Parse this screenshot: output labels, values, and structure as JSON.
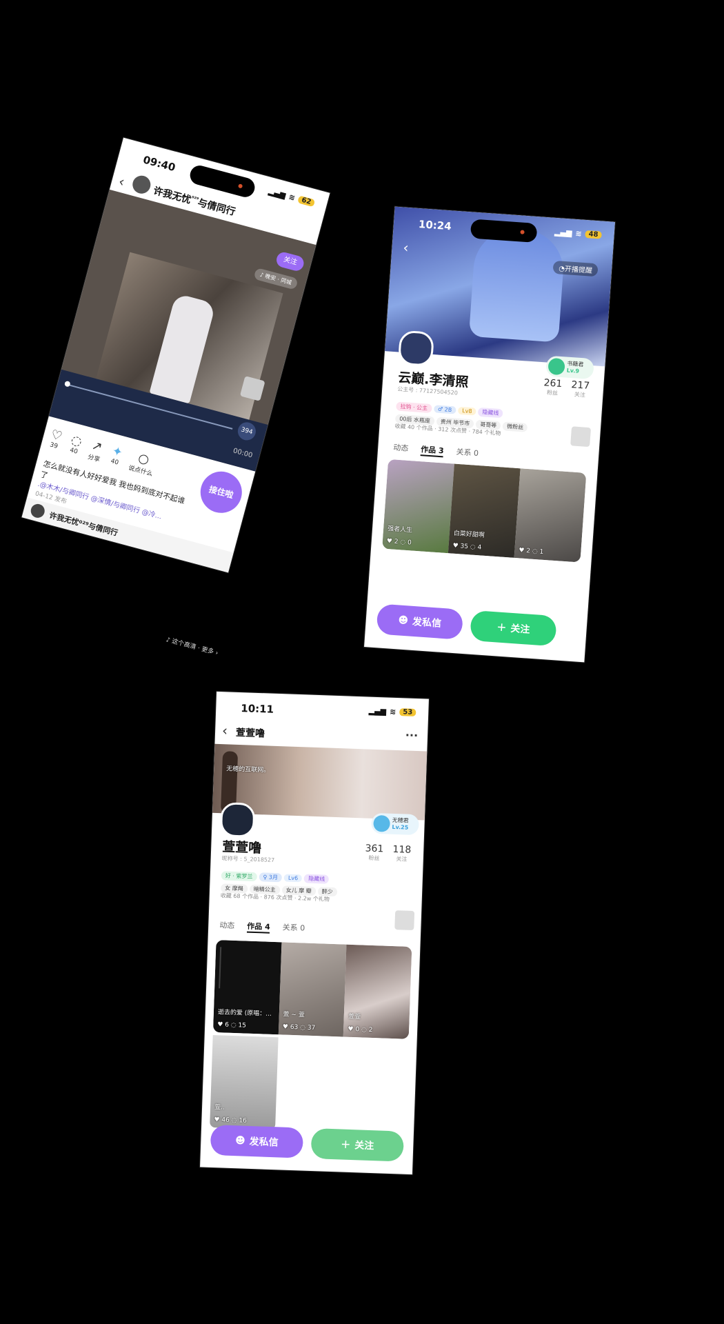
{
  "phone1": {
    "status": {
      "time": "09:40",
      "battery": "62"
    },
    "header": {
      "back": "‹",
      "username": "许我无忧",
      "superscript": "⁰²⁹",
      "suffix": "与倩同行",
      "follow_label": "关注"
    },
    "music_label": "♪ 晚安 · 同城",
    "sticker_badge": "394",
    "video_time": "00:00",
    "actions": [
      {
        "icon": "heart-icon",
        "count": "39"
      },
      {
        "icon": "comment-icon",
        "count": "40"
      },
      {
        "icon": "share-icon",
        "count": "分享"
      },
      {
        "icon": "gift-icon",
        "count": "40"
      },
      {
        "icon": "reply-icon",
        "count": "说点什么"
      }
    ],
    "join_button": "接住啦",
    "caption": "怎么就没有人好好爱我 我也妈到底对不起谁了",
    "mentions": ".@木木/与卿同行 @深情/与卿同行 @冷...",
    "date": "04-12 发布",
    "footer_user": "许我无忧⁰²⁹与倩同行",
    "footer_note": "♪ 这个高清 · 更多 ›"
  },
  "phone2": {
    "status": {
      "time": "10:24",
      "battery": "48"
    },
    "back": "‹",
    "remind_label": "开播提醒",
    "level_badge": {
      "name": "书籍君",
      "level": "Lv.9"
    },
    "name": "云巅.李清照",
    "id_line": "公主号 : 77127504520",
    "stats": [
      {
        "value": "261",
        "label": "粉丝"
      },
      {
        "value": "217",
        "label": "关注"
      }
    ],
    "tags": [
      "拉钩 · 公主",
      "♂ 2B",
      "Lv8",
      "隐藏线"
    ],
    "info_tags": [
      "00后 水瓶座",
      "贵州 毕节市",
      "哥哥等",
      "微粉丝"
    ],
    "collect_line": "收藏 40 个作品 · 312 次点赞 · 784 个礼物",
    "tabs": [
      "动态",
      "作品 3",
      "关系 0"
    ],
    "thumbs": [
      {
        "caption": "强者人生",
        "likes": "2",
        "comments": "0"
      },
      {
        "caption": "白菜好甜啊",
        "likes": "35",
        "comments": "4"
      },
      {
        "caption": "",
        "likes": "2",
        "comments": "1"
      }
    ],
    "dm_label": "发私信",
    "follow_label": "关注"
  },
  "phone3": {
    "status": {
      "time": "10:11",
      "battery": "53"
    },
    "back": "‹",
    "title": "萱萱噜",
    "more": "···",
    "banner_text": "无穂的互联网。",
    "level_badge": {
      "name": "无穂君",
      "level": "Lv.25"
    },
    "name": "萱萱噜",
    "id_line": "昵称号 : 5_2018527",
    "stats": [
      {
        "value": "361",
        "label": "粉丝"
      },
      {
        "value": "118",
        "label": "关注"
      }
    ],
    "tags": [
      "好 · 紫罗兰",
      "♀ 3月",
      "Lv6",
      "隐藏线"
    ],
    "info_tags": [
      "女 摩羯",
      "暗精公主",
      "女儿 摩 瓣",
      "醉少"
    ],
    "collect_line": "收藏 68 个作品 · 876 次点赞 · 2.2w 个礼物",
    "tabs": [
      "动态",
      "作品 4",
      "关系 0"
    ],
    "thumbs": [
      {
        "caption": "逝去的爱 (原唱：...",
        "likes": "6",
        "comments": "15"
      },
      {
        "caption": "萱 ~ 萱",
        "likes": "63",
        "comments": "37"
      },
      {
        "caption": "萱萱",
        "likes": "0",
        "comments": "2"
      },
      {
        "caption": "萱..",
        "likes": "46",
        "comments": "16"
      }
    ],
    "dm_label": "发私信",
    "follow_label": "关注"
  }
}
